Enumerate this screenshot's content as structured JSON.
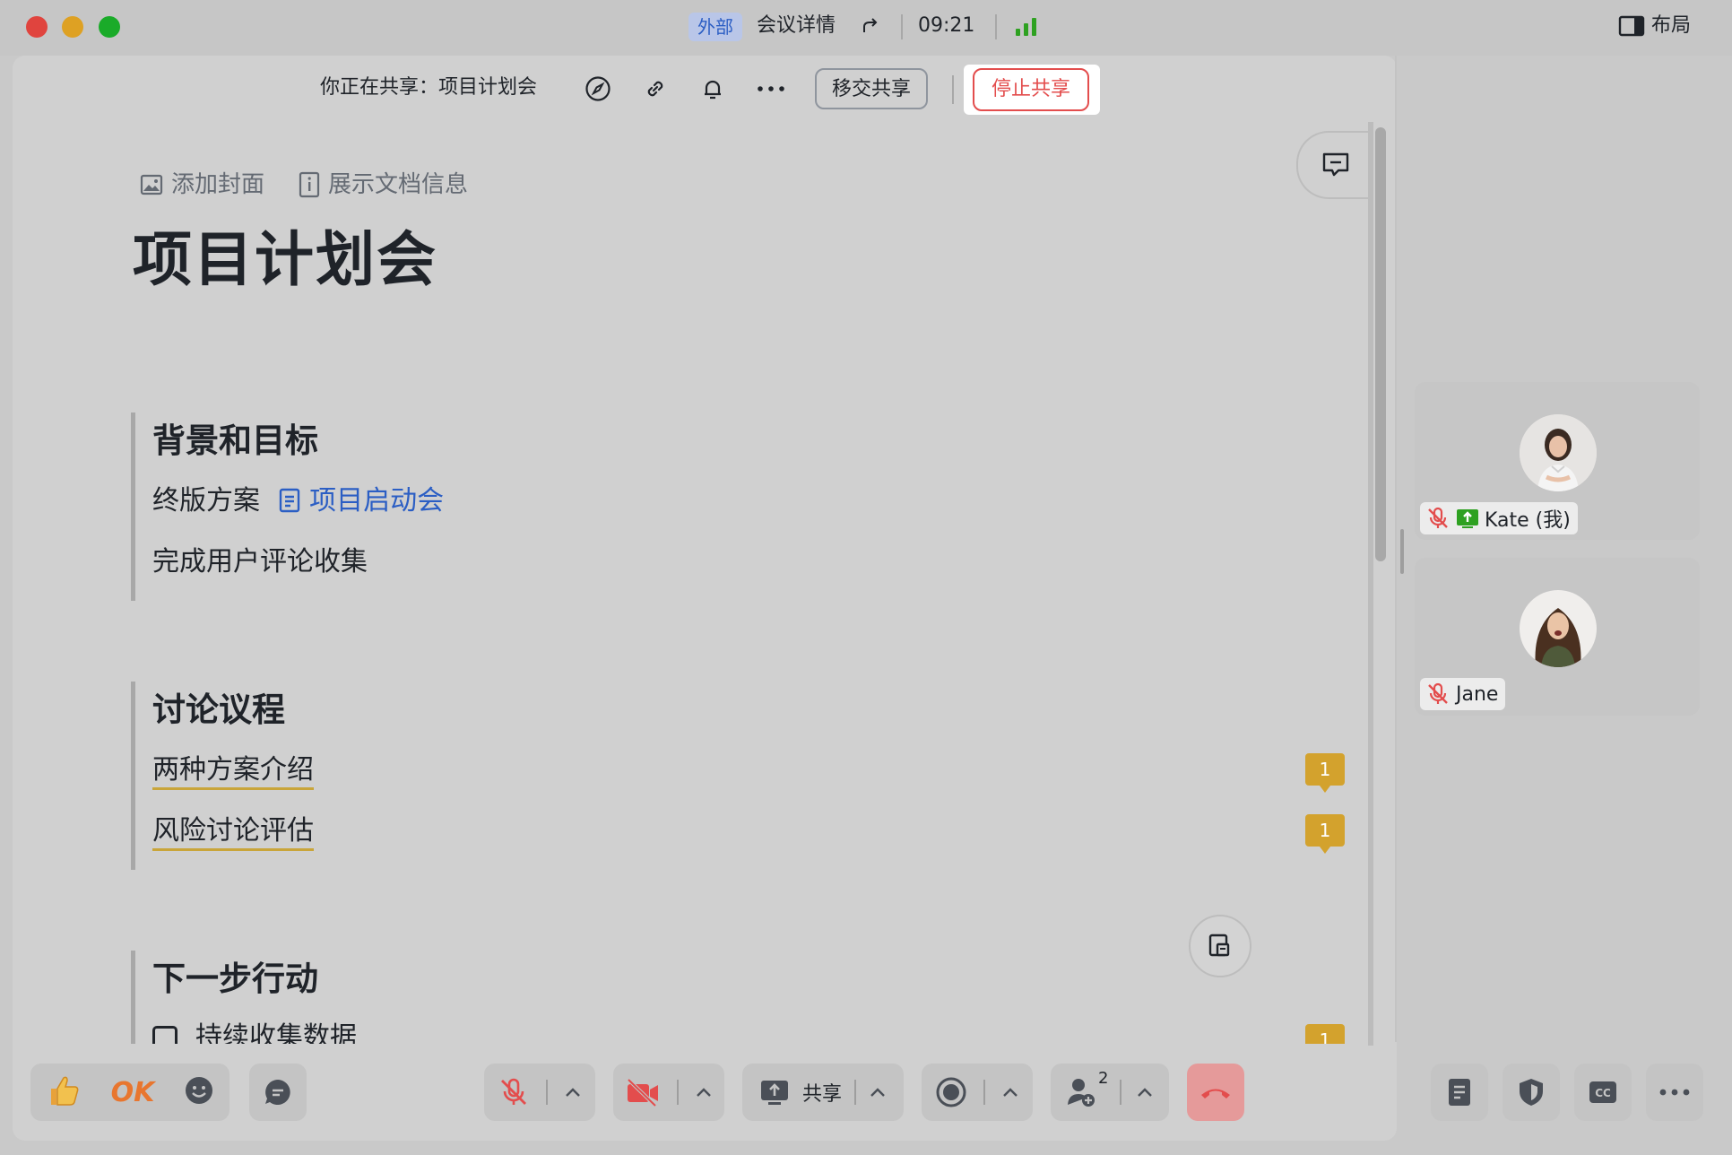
{
  "titlebar": {
    "tag": "外部",
    "meeting_details": "会议详情",
    "time": "09:21",
    "layout": "布局"
  },
  "share_header": {
    "label": "你正在共享：项目计划会",
    "transfer_button": "移交共享",
    "stop_button": "停止共享"
  },
  "doc": {
    "add_cover": "添加封面",
    "show_doc_info": "展示文档信息",
    "title": "项目计划会",
    "sections": [
      {
        "heading": "背景和目标",
        "lines": [
          {
            "text": "终版方案",
            "link": "项目启动会"
          },
          {
            "text": "完成用户评论收集"
          }
        ]
      },
      {
        "heading": "讨论议程",
        "lines": [
          {
            "text": "两种方案介绍",
            "comments": "1"
          },
          {
            "text": "风险讨论评估",
            "comments": "1"
          }
        ]
      },
      {
        "heading": "下一步行动",
        "lines": [
          {
            "text": "持续收集数据",
            "comments": "1"
          }
        ]
      }
    ]
  },
  "participants": [
    {
      "name": "Kate (我)",
      "muted": true,
      "sharing": true
    },
    {
      "name": "Jane",
      "muted": true,
      "sharing": false
    }
  ],
  "bottom_bar": {
    "ok_reaction": "OK",
    "share_label": "共享",
    "participant_count": "2"
  },
  "colors": {
    "accent_blue": "#2b5ec4",
    "stop_red": "#e34d4d",
    "comment_yellow": "#d3a22d",
    "signal_green": "#2ea121"
  }
}
